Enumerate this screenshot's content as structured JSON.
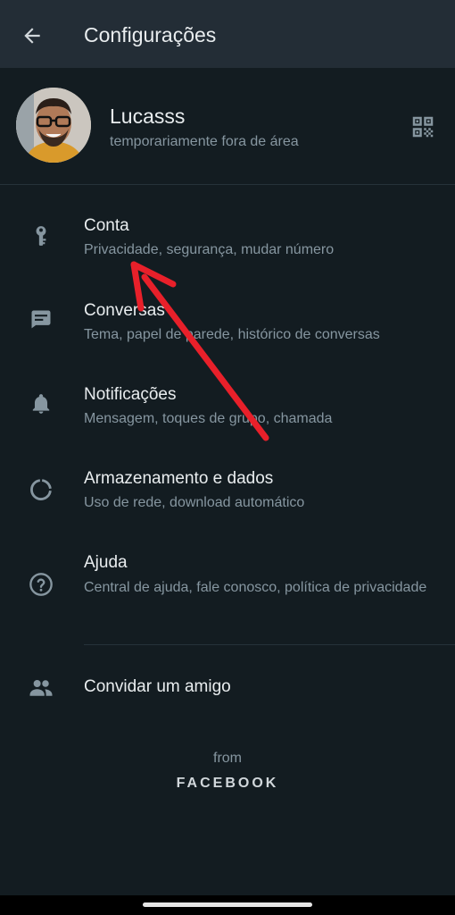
{
  "header": {
    "title": "Configurações"
  },
  "profile": {
    "name": "Lucasss",
    "status": "temporariamente fora de área"
  },
  "settings": [
    {
      "icon": "key-icon",
      "label": "Conta",
      "sub": "Privacidade, segurança, mudar número"
    },
    {
      "icon": "chat-icon",
      "label": "Conversas",
      "sub": "Tema, papel de parede, histórico de conversas"
    },
    {
      "icon": "bell-icon",
      "label": "Notificações",
      "sub": "Mensagem, toques de grupo, chamada"
    },
    {
      "icon": "data-usage-icon",
      "label": "Armazenamento e dados",
      "sub": "Uso de rede, download automático"
    },
    {
      "icon": "help-icon",
      "label": "Ajuda",
      "sub": "Central de ajuda, fale conosco, política de privacidade"
    }
  ],
  "invite": {
    "icon": "people-icon",
    "label": "Convidar um amigo"
  },
  "footer": {
    "from": "from",
    "brand": "FACEBOOK"
  },
  "colors": {
    "background": "#131c21",
    "topbar": "#232d36",
    "primary_text": "#e9edef",
    "secondary_text": "#8696a0",
    "icon": "#8696a0",
    "annotation_arrow": "#e8202a"
  }
}
